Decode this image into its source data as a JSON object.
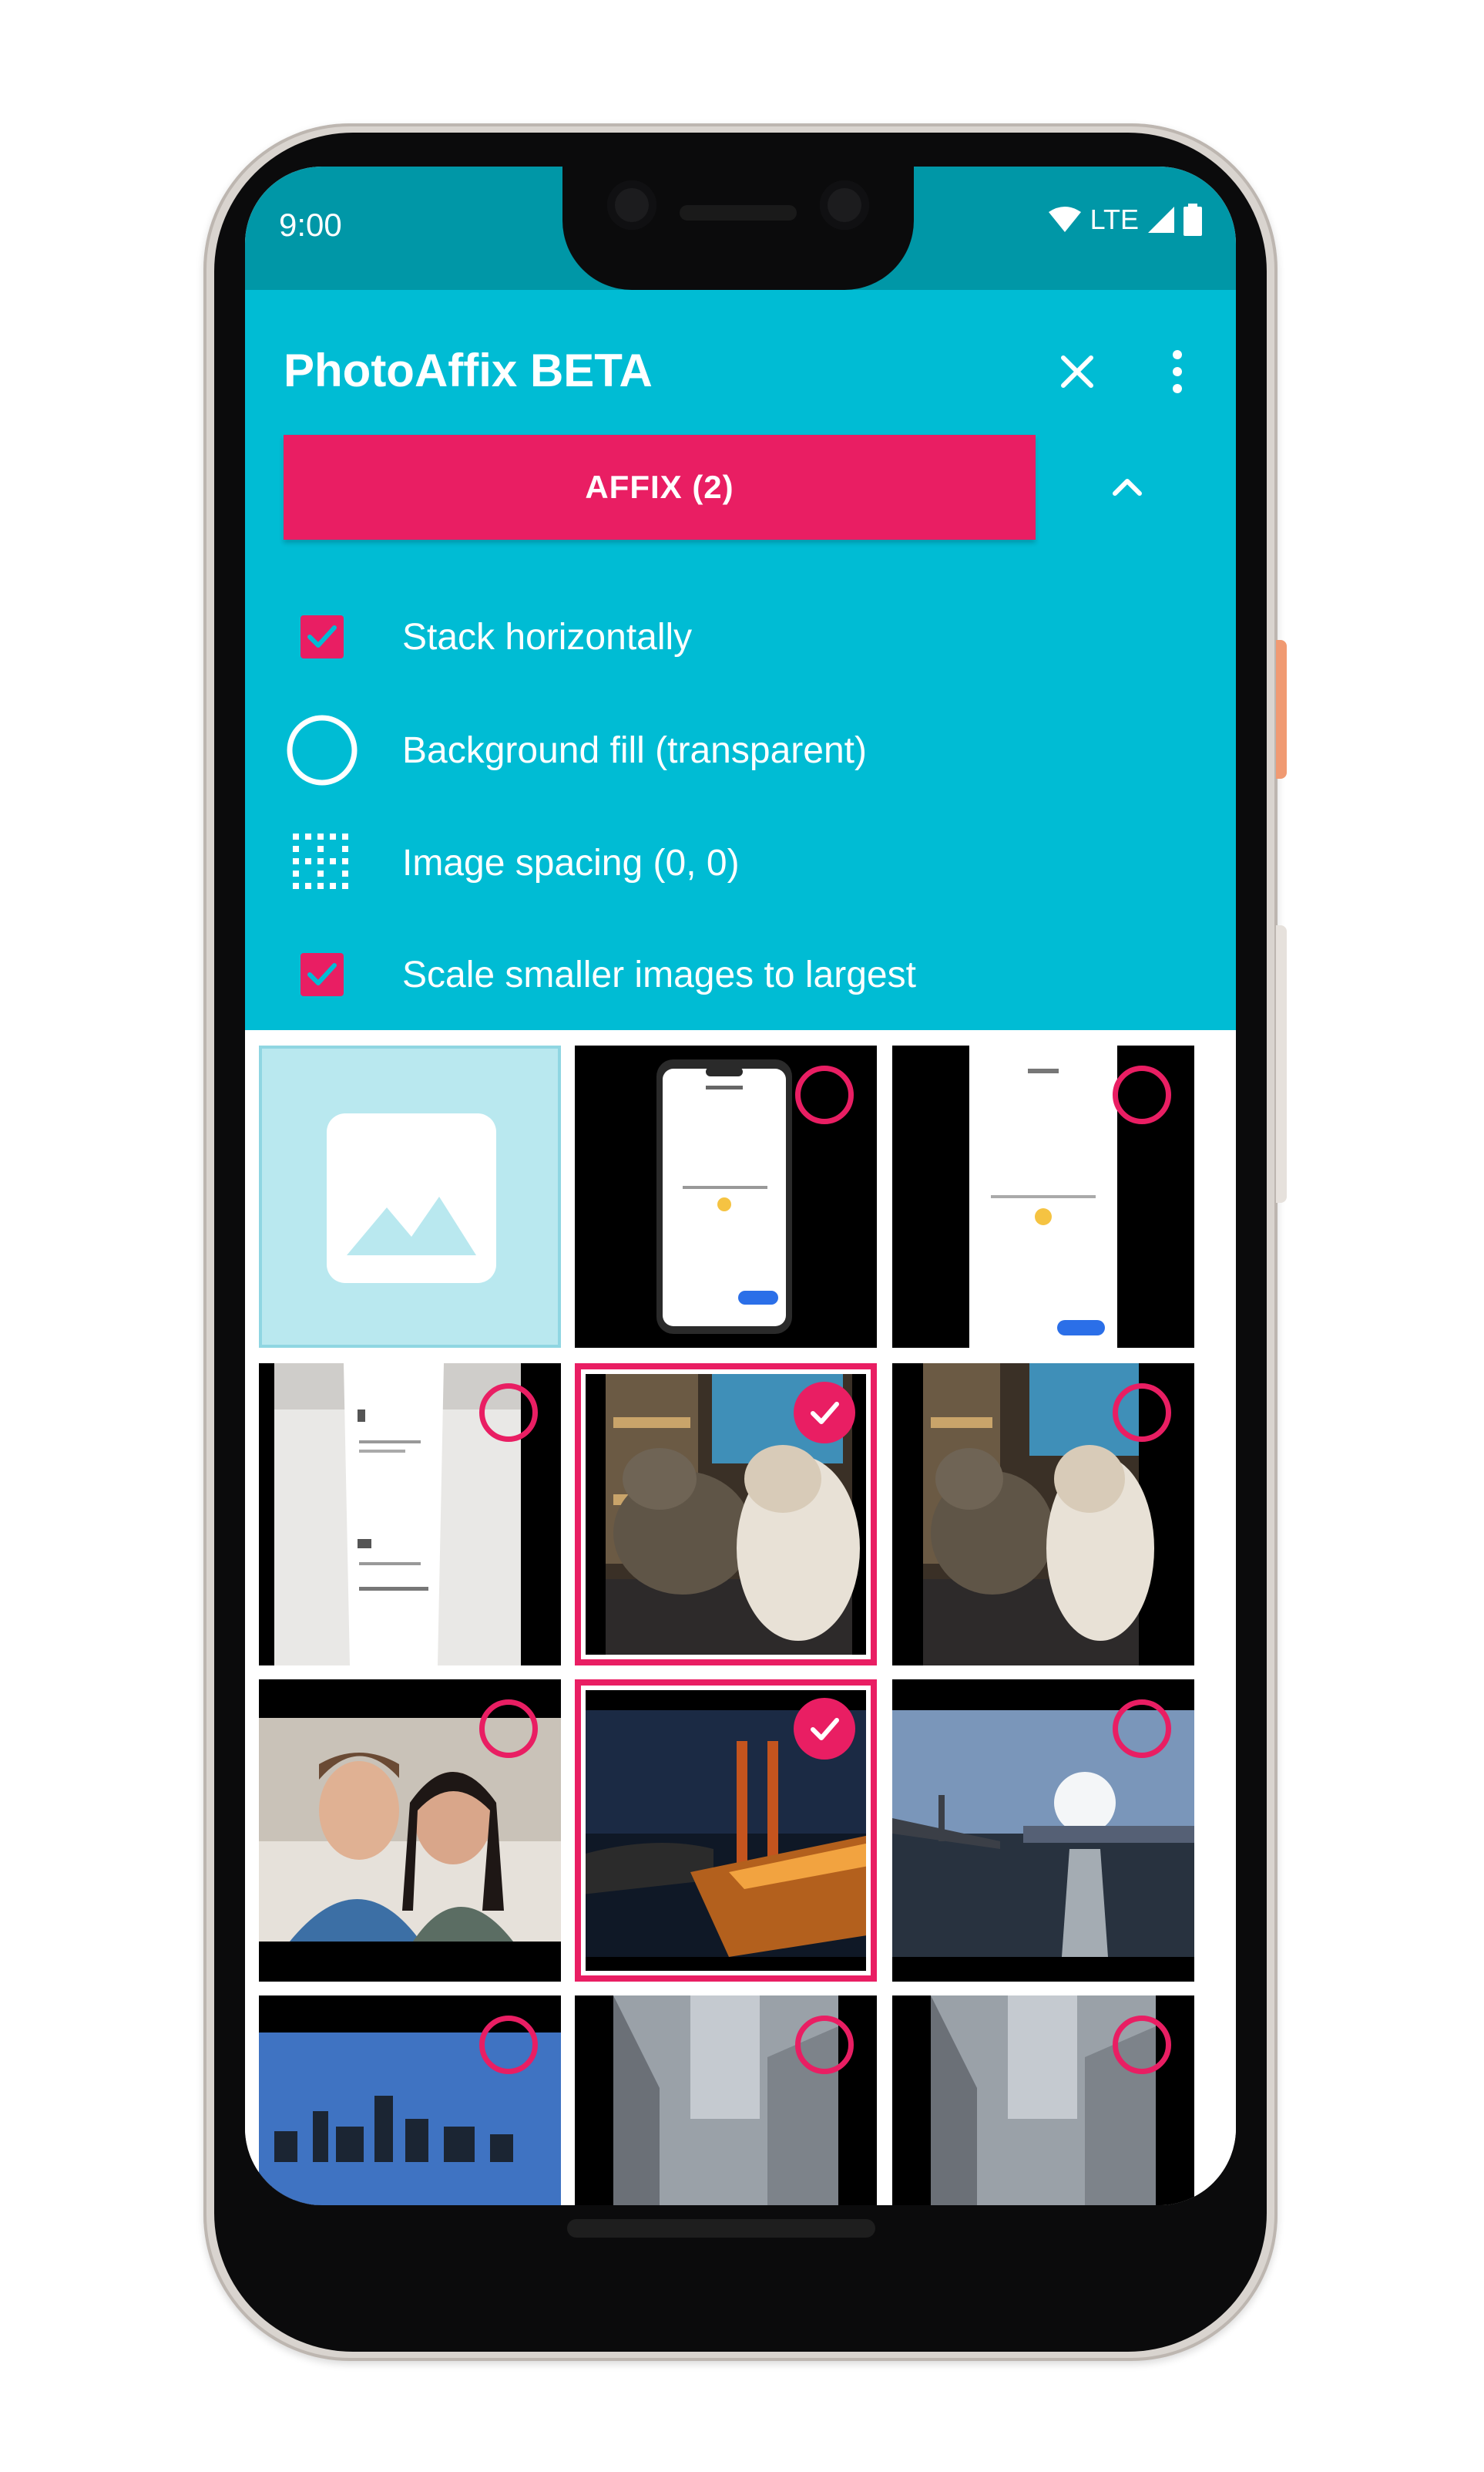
{
  "status_bar": {
    "time": "9:00",
    "network": "LTE",
    "icons": [
      "wifi-icon",
      "signal-icon",
      "battery-icon"
    ]
  },
  "app_bar": {
    "title": "PhotoAffix BETA",
    "actions": [
      "close-icon",
      "more-vert-icon"
    ]
  },
  "affix_button": {
    "label": "AFFIX (2)"
  },
  "options": [
    {
      "label": "Stack horizontally",
      "icon": "checkbox-checked-icon",
      "checked": true
    },
    {
      "label": "Background fill (transparent)",
      "icon": "circle-outline-icon"
    },
    {
      "label": "Image spacing (0, 0)",
      "icon": "dotted-grid-icon"
    },
    {
      "label": "Scale smaller images to largest",
      "icon": "checkbox-checked-icon",
      "checked": true
    }
  ],
  "grid": {
    "tiles": [
      {
        "kind": "image-placeholder",
        "selected": false
      },
      {
        "kind": "phone-screenshot-mock",
        "selected": false
      },
      {
        "kind": "app-screenshot",
        "selected": false
      },
      {
        "kind": "receipt-photo",
        "selected": false
      },
      {
        "kind": "cats-photo",
        "selected": true
      },
      {
        "kind": "cats-photo",
        "selected": false
      },
      {
        "kind": "selfie-couple-photo",
        "selected": false
      },
      {
        "kind": "bridge-night-photo",
        "selected": true
      },
      {
        "kind": "bay-bridge-photo",
        "selected": false
      },
      {
        "kind": "city-skyline-photo",
        "selected": false
      },
      {
        "kind": "foggy-building-photo",
        "selected": false
      },
      {
        "kind": "foggy-building-photo",
        "selected": false
      }
    ]
  },
  "colors": {
    "primary": "#00bcd4",
    "primary_dark": "#0097a7",
    "accent": "#e91e63"
  }
}
